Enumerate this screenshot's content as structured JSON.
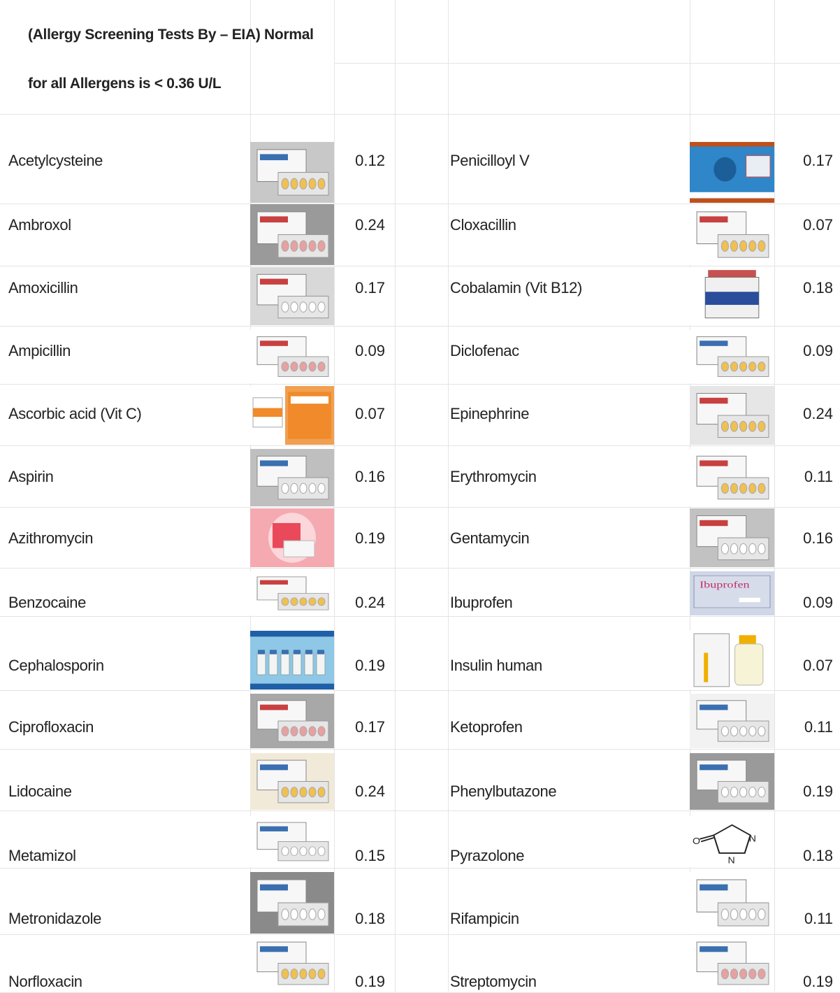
{
  "header": {
    "line1": "(Allergy Screening Tests By – EIA) Normal",
    "line2": "for all Allergens is < 0.36 U/L"
  },
  "left": [
    {
      "name": "Acetylcysteine",
      "value": "0.12",
      "icon": "pill-box-blister-image",
      "bg": "#c8c8c8"
    },
    {
      "name": "Ambroxol",
      "value": "0.24",
      "icon": "syrup-box-image",
      "bg": "#9a9a9a"
    },
    {
      "name": "Amoxicillin",
      "value": "0.17",
      "icon": "capsule-box-image",
      "bg": "#d8d8d8"
    },
    {
      "name": "Ampicillin",
      "value": "0.09",
      "icon": "red-capsule-box-image",
      "bg": "#ffffff"
    },
    {
      "name": "Ascorbic acid (Vit C)",
      "value": "0.07",
      "icon": "vitamin-c-pack-image",
      "bg": "#f0a050"
    },
    {
      "name": "Aspirin",
      "value": "0.16",
      "icon": "tablet-blister-image",
      "bg": "#bfbfbf"
    },
    {
      "name": "Azithromycin",
      "value": "0.19",
      "icon": "pink-pill-box-image",
      "bg": "#f5a9b0"
    },
    {
      "name": "Benzocaine",
      "value": "0.24",
      "icon": "ointment-tube-image",
      "bg": "#ffffff"
    },
    {
      "name": "Cephalosporin",
      "value": "0.19",
      "icon": "vial-row-image",
      "bg": "#8fc7e6"
    },
    {
      "name": "Ciprofloxacin",
      "value": "0.17",
      "icon": "infusion-bottle-image",
      "bg": "#a8a8a8"
    },
    {
      "name": "Lidocaine",
      "value": "0.24",
      "icon": "cream-tube-image",
      "bg": "#f2ead8"
    },
    {
      "name": "Metamizol",
      "value": "0.15",
      "icon": "white-pill-box-image",
      "bg": "#ffffff"
    },
    {
      "name": "Metronidazole",
      "value": "0.18",
      "icon": "gel-tube-image",
      "bg": "#8a8a8a"
    },
    {
      "name": "Norfloxacin",
      "value": "0.19",
      "icon": "tablet-box-image",
      "bg": "#ffffff"
    }
  ],
  "right": [
    {
      "name": "Penicilloyl V",
      "value": "0.17",
      "icon": "blue-medicine-card-image",
      "bg": "#2a7fc4"
    },
    {
      "name": "Cloxacillin",
      "value": "0.07",
      "icon": "capsule-strip-image",
      "bg": "#ffffff"
    },
    {
      "name": "Cobalamin (Vit B12)",
      "value": "0.18",
      "icon": "b12-jar-image",
      "bg": "#ffffff"
    },
    {
      "name": "Diclofenac",
      "value": "0.09",
      "icon": "yellow-box-image",
      "bg": "#ffffff"
    },
    {
      "name": "Epinephrine",
      "value": "0.24",
      "icon": "auto-injector-image",
      "bg": "#e6e6e6"
    },
    {
      "name": "Erythromycin",
      "value": "0.11",
      "icon": "pink-tablet-blister-image",
      "bg": "#ffffff"
    },
    {
      "name": "Gentamycin",
      "value": "0.16",
      "icon": "ampoule-box-image",
      "bg": "#c2c2c2"
    },
    {
      "name": "Ibuprofen",
      "value": "0.09",
      "icon": "ibuprofen-box-image",
      "bg": "#cfd6e6"
    },
    {
      "name": "Insulin human",
      "value": "0.07",
      "icon": "insulin-vial-image",
      "bg": "#ffffff"
    },
    {
      "name": "Ketoprofen",
      "value": "0.11",
      "icon": "ketoprofen-box-image",
      "bg": "#f2f2f2"
    },
    {
      "name": "Phenylbutazone",
      "value": "0.19",
      "icon": "grey-box-image",
      "bg": "#9a9a9a"
    },
    {
      "name": "Pyrazolone",
      "value": "0.18",
      "icon": "pyrazolone-structure-image",
      "bg": "#ffffff"
    },
    {
      "name": "Rifampicin",
      "value": "0.11",
      "icon": "capsule-carton-image",
      "bg": "#ffffff"
    },
    {
      "name": "Streptomycin",
      "value": "0.19",
      "icon": "vial-and-box-image",
      "bg": "#ffffff"
    }
  ],
  "images": {
    "ibuprofen_label": "Ibuprofen"
  }
}
